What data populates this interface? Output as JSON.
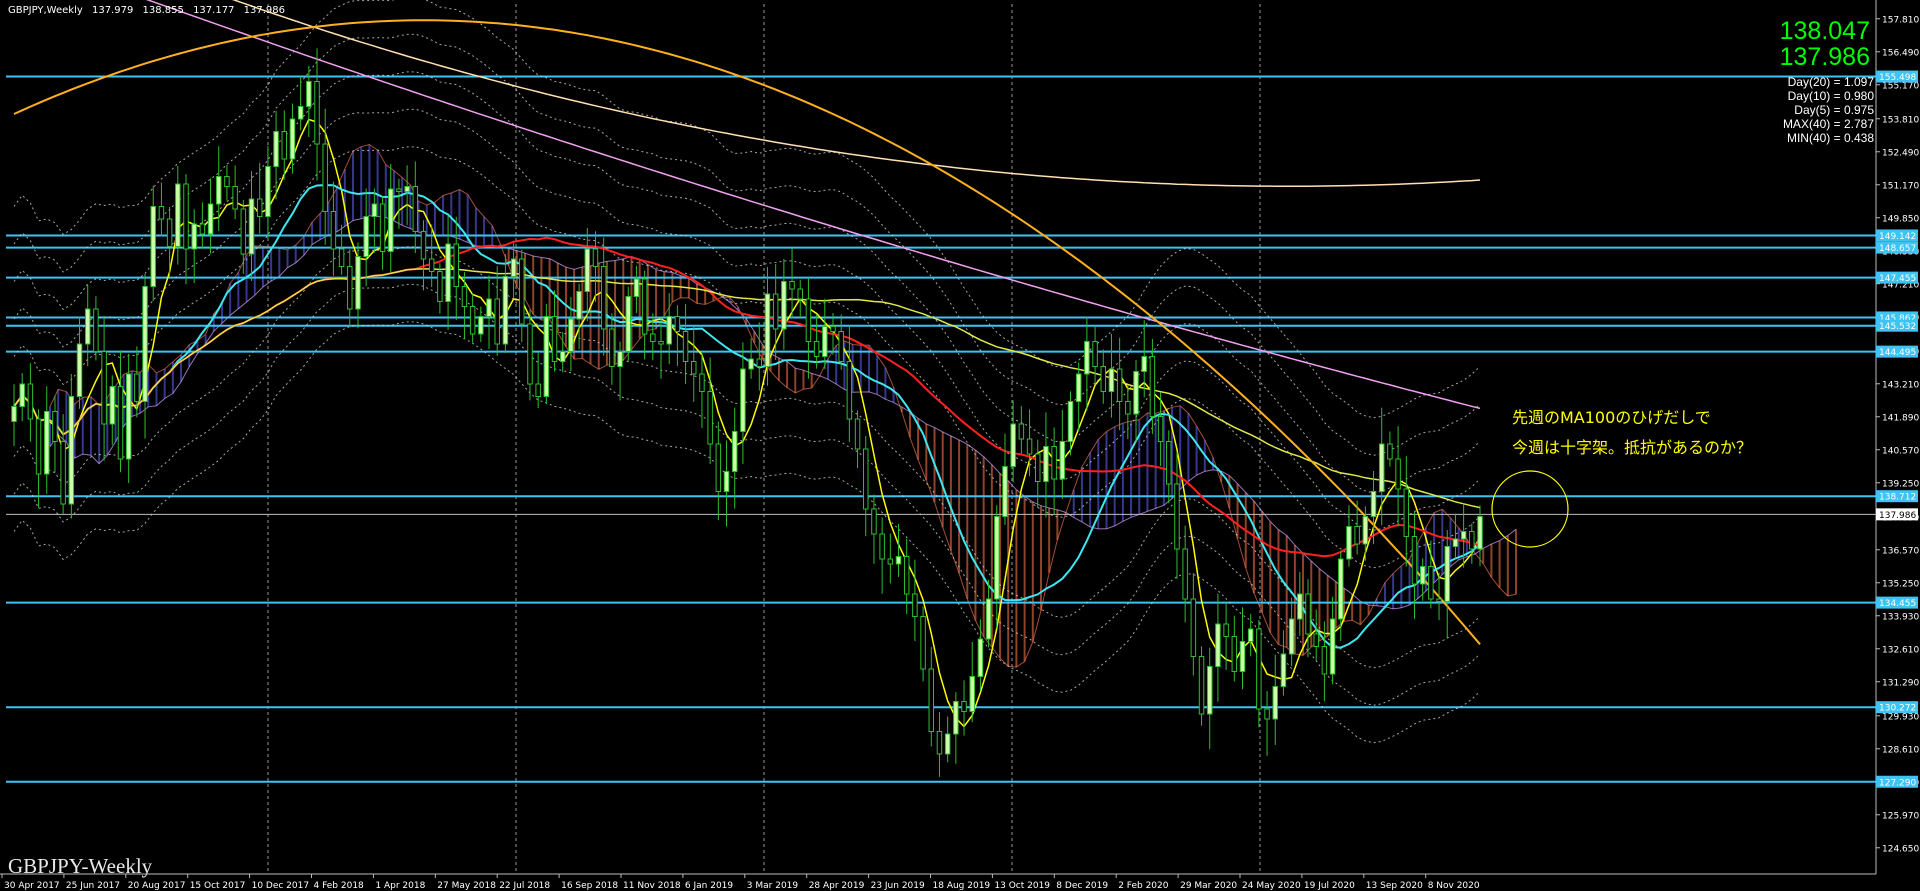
{
  "header": {
    "symbol": "GBPJPY,Weekly",
    "open": "137.979",
    "high": "138.855",
    "low": "137.177",
    "close": "137.986"
  },
  "quote": {
    "bid": "138.047",
    "ask": "137.986"
  },
  "stats": [
    "Day(20) = 1.097",
    "Day(10) = 0.980",
    "Day(5) = 0.975",
    "MAX(40) = 2.787",
    "MIN(40) = 0.438"
  ],
  "annotation": {
    "line1": "先週のMA100のひげだしで",
    "line2": "今週は十字架。抵抗があるのか？"
  },
  "watermark": "GBPJPY-Weekly",
  "colors": {
    "background": "#000000",
    "grid": "#9a9a9a",
    "bull_candle": "#ccffaa",
    "wick": "#2fbf2f",
    "level_line": "#3ec3f3",
    "ma_fast": "#ffff00",
    "ma_20": "#3ee6f0",
    "ma_50": "#ff2020",
    "ma_100": "#dfe84a",
    "ma_200": "#f0a0f0",
    "ma_300": "#ffe0b0",
    "ma_orange": "#ffb020",
    "cloud_red": "#c05a3a",
    "cloud_blue": "#4a4ac0",
    "annotation_text": "#ffff00",
    "quote_text": "#00ff00"
  },
  "chart_data": {
    "type": "candlestick",
    "ylim": [
      123.6,
      158.4
    ],
    "y_ticks": [
      "157.810",
      "156.490",
      "155.170",
      "153.810",
      "152.490",
      "151.170",
      "149.850",
      "148.530",
      "147.210",
      "145.890",
      "144.530",
      "143.210",
      "141.890",
      "140.570",
      "139.250",
      "137.890",
      "136.570",
      "135.250",
      "133.930",
      "132.610",
      "131.290",
      "129.930",
      "128.610",
      "127.290",
      "125.970",
      "124.650",
      "123.330"
    ],
    "x_ticks": [
      "30 Apr 2017",
      "25 Jun 2017",
      "20 Aug 2017",
      "15 Oct 2017",
      "10 Dec 2017",
      "4 Feb 2018",
      "1 Apr 2018",
      "27 May 2018",
      "22 Jul 2018",
      "16 Sep 2018",
      "11 Nov 2018",
      "6 Jan 2019",
      "3 Mar 2019",
      "28 Apr 2019",
      "23 Jun 2019",
      "18 Aug 2019",
      "13 Oct 2019",
      "8 Dec 2019",
      "2 Feb 2020",
      "29 Mar 2020",
      "24 May 2020",
      "19 Jul 2020",
      "13 Sep 2020",
      "8 Nov 2020"
    ],
    "levels": [
      {
        "label": "155.498",
        "value": 155.498
      },
      {
        "label": "149.142",
        "value": 149.142
      },
      {
        "label": "148.657",
        "value": 148.657
      },
      {
        "label": "147.455",
        "value": 147.455
      },
      {
        "label": "145.862",
        "value": 145.862
      },
      {
        "label": "145.532",
        "value": 145.532
      },
      {
        "label": "144.495",
        "value": 144.495
      },
      {
        "label": "138.712",
        "value": 138.712
      },
      {
        "label": "134.455",
        "value": 134.455
      },
      {
        "label": "130.272",
        "value": 130.272
      },
      {
        "label": "127.290",
        "value": 127.29
      }
    ],
    "current_price": {
      "label": "137.986",
      "value": 137.986
    },
    "close_series": [
      142.3,
      143.2,
      141.8,
      139.6,
      142.1,
      140.9,
      138.4,
      142.7,
      144.8,
      146.2,
      144.5,
      141.6,
      143.1,
      140.2,
      143.6,
      142.5,
      147.1,
      150.3,
      149.8,
      148.7,
      151.2,
      148.6,
      149.6,
      149.2,
      150.4,
      151.5,
      151.1,
      150.2,
      148.4,
      150.6,
      149.9,
      151.9,
      153.3,
      152.2,
      153.8,
      154.3,
      155.3,
      152.8,
      150.1,
      148.6,
      147.9,
      146.2,
      148.3,
      149.9,
      150.4,
      148.5,
      151.0,
      150.9,
      151.1,
      149.3,
      148.2,
      147.7,
      146.5,
      148.8,
      147.1,
      146.3,
      145.2,
      145.9,
      146.6,
      144.8,
      147.5,
      148.2,
      145.6,
      143.2,
      142.7,
      145.9,
      144.1,
      144.5,
      145.8,
      146.9,
      148.6,
      147.9,
      145.4,
      143.9,
      144.5,
      146.7,
      147.4,
      145.2,
      144.9,
      144.8,
      145.9,
      145.3,
      144.1,
      143.6,
      142.9,
      140.8,
      138.9,
      139.7,
      141.3,
      143.8,
      144.2,
      143.9,
      146.8,
      145.4,
      147.3,
      147.0,
      146.6,
      144.9,
      144.3,
      145.5,
      145.3,
      144.1,
      141.8,
      140.6,
      138.2,
      137.2,
      136.2,
      136.0,
      136.3,
      134.8,
      133.9,
      131.8,
      129.3,
      128.4,
      129.2,
      130.5,
      130.1,
      131.5,
      133.0,
      134.6,
      137.9,
      139.9,
      141.6,
      141.0,
      140.4,
      139.3,
      140.7,
      139.4,
      140.9,
      142.5,
      143.6,
      144.9,
      143.9,
      142.9,
      143.8,
      142.5,
      142.0,
      143.7,
      144.3,
      141.9,
      140.9,
      139.2,
      136.6,
      134.6,
      132.3,
      130.0,
      131.9,
      133.6,
      133.1,
      131.7,
      132.9,
      133.4,
      130.2,
      129.8,
      131.1,
      132.4,
      133.8,
      134.8,
      133.2,
      132.7,
      131.6,
      133.8,
      136.2,
      137.5,
      136.8,
      137.9,
      138.9,
      140.8,
      140.2,
      139.0,
      137.1,
      135.2,
      135.9,
      134.6,
      134.5,
      136.7,
      137.0,
      137.3,
      136.6,
      137.9
    ]
  }
}
